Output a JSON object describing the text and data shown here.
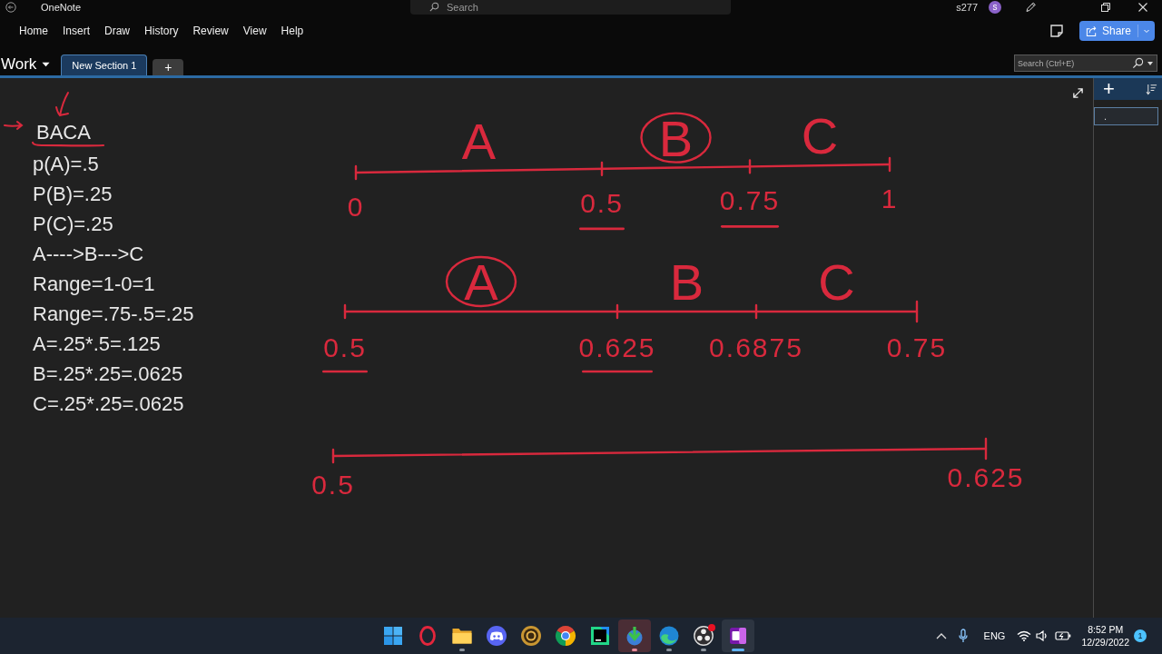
{
  "title_bar": {
    "app_name": "OneNote",
    "search_placeholder": "Search",
    "user_name": "s277",
    "avatar_initial": "s"
  },
  "ribbon": {
    "tabs": [
      {
        "label": "Home",
        "selected": false
      },
      {
        "label": "Insert",
        "selected": false
      },
      {
        "label": "Draw",
        "selected": false
      },
      {
        "label": "History",
        "selected": false
      },
      {
        "label": "Review",
        "selected": false
      },
      {
        "label": "View",
        "selected": false
      },
      {
        "label": "Help",
        "selected": false
      }
    ],
    "share_button": "Share"
  },
  "section_bar": {
    "notebook": "Work",
    "sections": [
      {
        "label": "New Section 1",
        "selected": true
      }
    ],
    "add_section": "+",
    "search_placeholder": "Search (Ctrl+E)"
  },
  "page_list": {
    "add_page": "+",
    "pages": [
      {
        "title": ".",
        "selected": true
      }
    ]
  },
  "notes": {
    "heading": {
      "text": "BACA",
      "underlined": true
    },
    "lines": [
      "p(A)=.5",
      "P(B)=.25",
      "P(C)=.25",
      "A---->B--->C",
      "Range=1-0=1",
      "Range=.75-.5=.25",
      "A=.25*.5=.125",
      "B=.25*.25=.0625",
      "C=.25*.25=.0625"
    ]
  },
  "ink": {
    "number_lines": [
      {
        "segments": [
          {
            "label": "A",
            "circled": false
          },
          {
            "label": "B",
            "circled": true
          },
          {
            "label": "C",
            "circled": false
          }
        ],
        "ticks": [
          {
            "label": "0",
            "underlined": false
          },
          {
            "label": "0.5",
            "underlined": true
          },
          {
            "label": "0.75",
            "underlined": true
          },
          {
            "label": "1",
            "underlined": false
          }
        ]
      },
      {
        "segments": [
          {
            "label": "A",
            "circled": true
          },
          {
            "label": "B",
            "circled": false
          },
          {
            "label": "C",
            "circled": false
          }
        ],
        "ticks": [
          {
            "label": "0.5",
            "underlined": true
          },
          {
            "label": "0.625",
            "underlined": true
          },
          {
            "label": "0.6875",
            "underlined": false
          },
          {
            "label": "0.75",
            "underlined": false
          }
        ]
      },
      {
        "ticks": [
          {
            "label": "0.5",
            "underlined": false
          },
          {
            "label": "0.625",
            "underlined": false
          }
        ]
      }
    ]
  },
  "taskbar": {
    "apps": [
      {
        "running": false,
        "focused": false,
        "flashing": false,
        "alert": false
      },
      {
        "running": true,
        "focused": false,
        "flashing": false,
        "alert": false
      },
      {
        "running": false,
        "focused": false,
        "flashing": false,
        "alert": false
      },
      {
        "running": false,
        "focused": false,
        "flashing": false,
        "alert": false
      },
      {
        "running": false,
        "focused": false,
        "flashing": false,
        "alert": false
      },
      {
        "running": false,
        "focused": false,
        "flashing": false,
        "alert": false
      },
      {
        "running": true,
        "focused": false,
        "flashing": true,
        "alert": false
      },
      {
        "running": true,
        "focused": false,
        "flashing": false,
        "alert": false
      },
      {
        "running": true,
        "focused": false,
        "flashing": false,
        "alert": true
      },
      {
        "running": true,
        "focused": true,
        "flashing": false,
        "alert": false
      }
    ],
    "language": "ENG",
    "time": "8:52 PM",
    "date": "12/29/2022",
    "notifications": "1"
  }
}
